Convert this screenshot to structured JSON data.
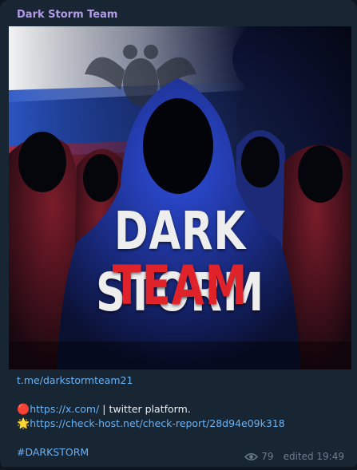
{
  "message": {
    "sender": "Dark Storm Team",
    "poster": {
      "line1": "DARK STORM",
      "line2": "TEAM"
    },
    "channel_link": "t.me/darkstormteam21",
    "line2_emoji": "🔴",
    "line2_link": "https://x.com/",
    "line2_suffix": " | twitter platform.",
    "line3_emoji": "🌟",
    "line3_link": "https://check-host.net/check-report/28d94e09k318",
    "hashtag": "#DARKSTORM",
    "views": "79",
    "edited": "edited 19:49"
  },
  "colors": {
    "bubble": "#182533",
    "sender": "#b59be7",
    "link": "#6ab3f3",
    "meta": "#6d7f8f",
    "poster_red": "#e0232a"
  }
}
